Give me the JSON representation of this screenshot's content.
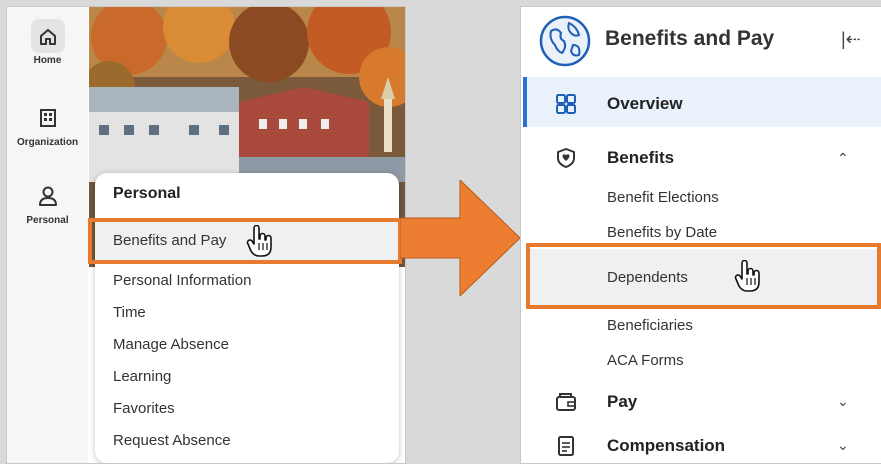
{
  "left_panel": {
    "rail": [
      {
        "label": "Home",
        "icon": "home-icon"
      },
      {
        "label": "Organization",
        "icon": "organization-icon"
      },
      {
        "label": "Personal",
        "icon": "person-icon"
      }
    ],
    "menu": {
      "title": "Personal",
      "items": [
        "Benefits and Pay",
        "Personal Information",
        "Time",
        "Manage Absence",
        "Learning",
        "Favorites",
        "Request Absence"
      ],
      "highlighted_item": "Benefits and Pay"
    }
  },
  "right_panel": {
    "title": "Benefits and Pay",
    "collapse_icon": "collapse-left-icon",
    "items": {
      "overview": "Overview",
      "benefits": "Benefits",
      "benefit_elections": "Benefit Elections",
      "benefits_by_date": "Benefits by Date",
      "dependents": "Dependents",
      "beneficiaries": "Beneficiaries",
      "aca_forms": "ACA Forms",
      "pay": "Pay",
      "compensation": "Compensation"
    },
    "highlighted_item": "Dependents"
  },
  "colors": {
    "highlight": "#e87a2d",
    "accent": "#2b6fd6"
  }
}
